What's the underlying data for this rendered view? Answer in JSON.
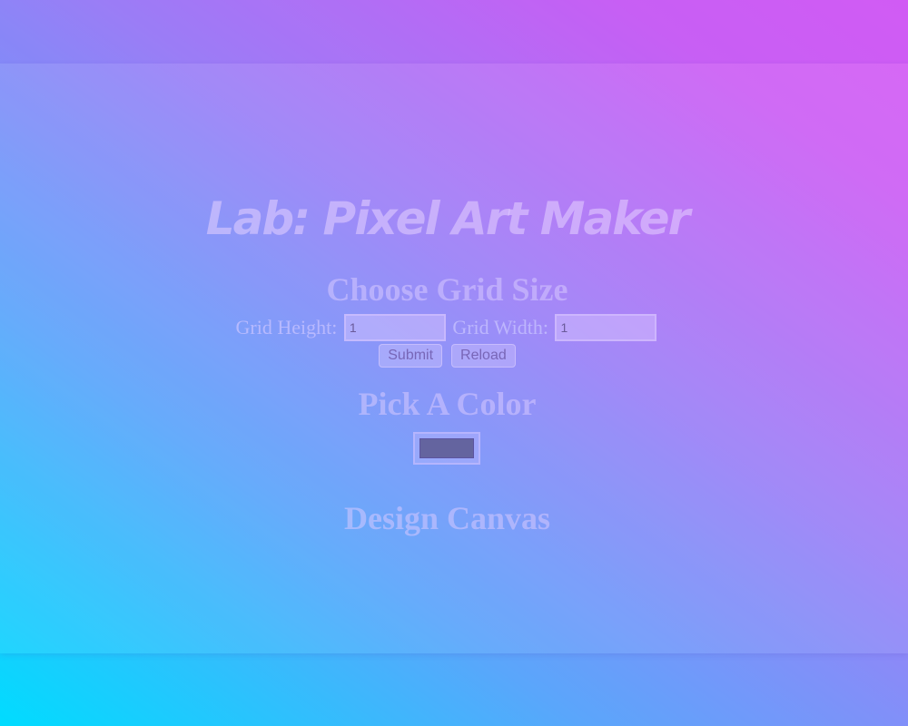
{
  "page": {
    "title": "Lab: Pixel Art Maker"
  },
  "grid_section": {
    "heading": "Choose Grid Size",
    "height_label": "Grid Height:",
    "height_value": "1",
    "width_label": "Grid Width:",
    "width_value": "1",
    "submit_label": "Submit",
    "reload_label": "Reload"
  },
  "color_section": {
    "heading": "Pick A Color",
    "selected_color": "#64649f"
  },
  "canvas_section": {
    "heading": "Design Canvas"
  },
  "colors": {
    "gradient_start": "#00dcff",
    "gradient_end": "#d65cf5"
  }
}
